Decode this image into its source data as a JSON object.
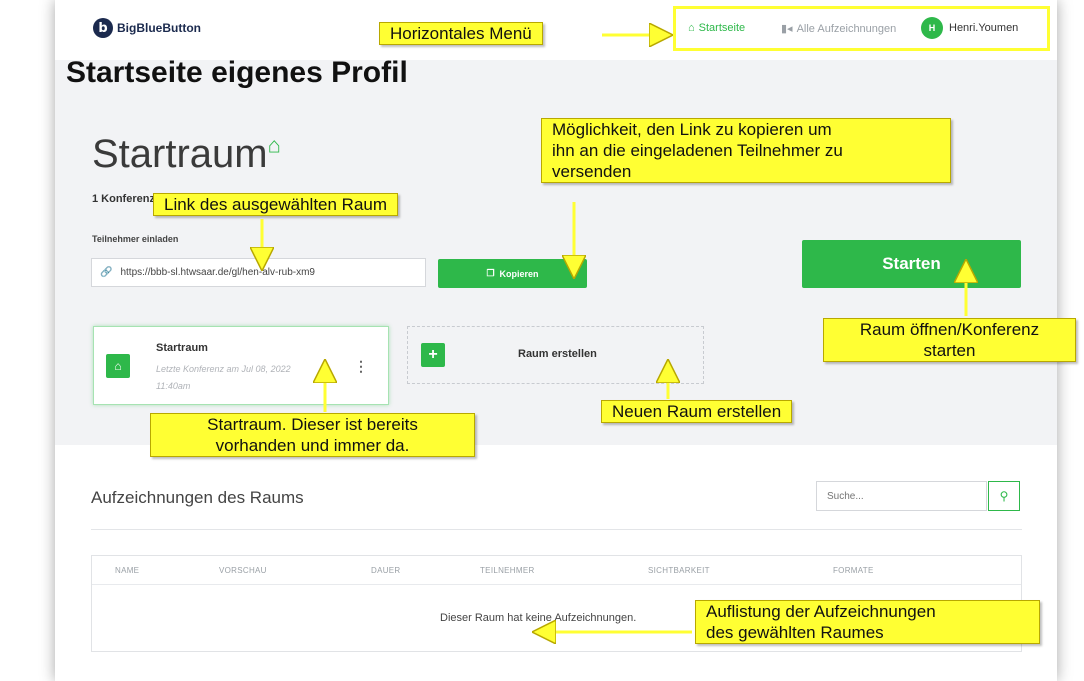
{
  "app": {
    "logo_letter": "b",
    "logo_text": "BigBlueButton"
  },
  "nav": {
    "home_label": "Startseite",
    "recordings_label": "Alle Aufzeichnungen",
    "user_initial": "H",
    "user_name": "Henri.Youmen"
  },
  "page": {
    "heading": "Startseite eigenes Profil"
  },
  "room": {
    "title": "Startraum",
    "conference_count": "1 Konferenz",
    "invite_label": "Teilnehmer einladen",
    "invite_link": "https://bbb-sl.htwsaar.de/gl/hen-alv-rub-xm9",
    "copy_label": "Kopieren",
    "start_label": "Starten"
  },
  "room_card": {
    "name": "Startraum",
    "meta_line1": "Letzte Konferenz am Jul 08, 2022",
    "meta_line2": "11:40am"
  },
  "create_room": {
    "label": "Raum erstellen"
  },
  "recordings": {
    "title": "Aufzeichnungen des Raums",
    "search_placeholder": "Suche...",
    "columns": [
      "NAME",
      "VORSCHAU",
      "DAUER",
      "TEILNEHMER",
      "SICHTBARKEIT",
      "FORMATE"
    ],
    "empty_message": "Dieser Raum hat keine Aufzeichnungen."
  },
  "annotations": {
    "menu": "Horizontales Menü",
    "link": "Link des ausgewählten Raum",
    "copy_line1": "Möglichkeit, den Link zu kopieren um",
    "copy_line2": "ihn an die eingeladenen Teilnehmer zu",
    "copy_line3": "versenden",
    "start_line1": "Raum öffnen/Konferenz",
    "start_line2": "starten",
    "startroom_line1": "Startraum. Dieser ist bereits",
    "startroom_line2": "vorhanden und immer da.",
    "new_room": "Neuen Raum erstellen",
    "recordings_line1": "Auflistung der Aufzeichnungen",
    "recordings_line2": "des gewählten Raumes"
  },
  "colors": {
    "accent": "#2eb84a",
    "annotation": "#ffff33",
    "background": "#f2f3f5"
  }
}
